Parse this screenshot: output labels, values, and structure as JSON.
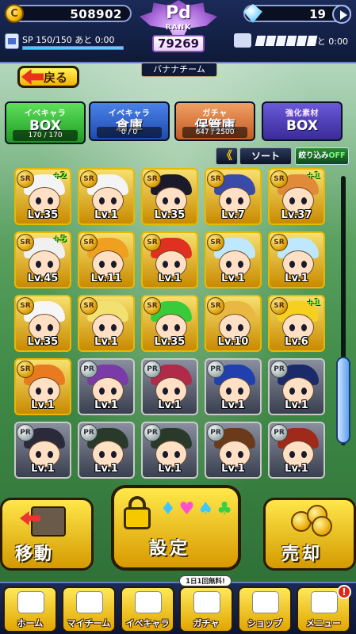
{
  "header": {
    "coins": "508902",
    "gems": "19",
    "sp_text": "SP 150/150 あと  0:00",
    "stamina_text": "あと  0:00",
    "rank_letter": "Pd",
    "rank_label": "RANK",
    "rank_value": "79269",
    "team_name": "バナナチーム",
    "back_label": "戻る"
  },
  "tabs": [
    {
      "line1": "イベキャラ",
      "line2": "BOX",
      "count": "170 / 170"
    },
    {
      "line1": "イベキャラ",
      "line2": "倉庫",
      "count": "0 / 0"
    },
    {
      "line1": "ガチャ",
      "line2": "保管庫",
      "count": "647 / 2500"
    },
    {
      "line1": "強化素材",
      "line2": "BOX",
      "count": ""
    }
  ],
  "toolbar": {
    "sort_arrow": "《",
    "sort_label": "ソート",
    "filter_label": "絞り込み",
    "filter_state": "OFF"
  },
  "cards": [
    {
      "rarity": "SR",
      "level": "Lv.35",
      "plus": "+2",
      "hair": "#f4f4f4"
    },
    {
      "rarity": "SR",
      "level": "Lv.1",
      "plus": "",
      "hair": "#f4f4f4"
    },
    {
      "rarity": "SR",
      "level": "Lv.35",
      "plus": "",
      "hair": "#1a1a2a"
    },
    {
      "rarity": "SR",
      "level": "Lv.7",
      "plus": "",
      "hair": "#3a4aa8"
    },
    {
      "rarity": "SR",
      "level": "Lv.37",
      "plus": "+1",
      "hair": "#e08a3a"
    },
    {
      "rarity": "SR",
      "level": "Lv.45",
      "plus": "+5",
      "hair": "#f0f0f0"
    },
    {
      "rarity": "SR",
      "level": "Lv.11",
      "plus": "",
      "hair": "#f0a020"
    },
    {
      "rarity": "SR",
      "level": "Lv.1",
      "plus": "",
      "hair": "#e03020"
    },
    {
      "rarity": "SR",
      "level": "Lv.1",
      "plus": "",
      "hair": "#bfe8ff"
    },
    {
      "rarity": "SR",
      "level": "Lv.1",
      "plus": "",
      "hair": "#bfe8ff"
    },
    {
      "rarity": "SR",
      "level": "Lv.35",
      "plus": "",
      "hair": "#f6f6f6"
    },
    {
      "rarity": "SR",
      "level": "Lv.1",
      "plus": "",
      "hair": "#f2e070"
    },
    {
      "rarity": "SR",
      "level": "Lv.35",
      "plus": "",
      "hair": "#3acb3a"
    },
    {
      "rarity": "SR",
      "level": "Lv.10",
      "plus": "",
      "hair": "#e8b840"
    },
    {
      "rarity": "SR",
      "level": "Lv.6",
      "plus": "+1",
      "hair": "#f5d020"
    },
    {
      "rarity": "SR",
      "level": "Lv.1",
      "plus": "",
      "hair": "#e87a20"
    },
    {
      "rarity": "PR",
      "level": "Lv.1",
      "plus": "",
      "hair": "#7a3aa8"
    },
    {
      "rarity": "PR",
      "level": "Lv.1",
      "plus": "",
      "hair": "#b02a4a"
    },
    {
      "rarity": "PR",
      "level": "Lv.1",
      "plus": "",
      "hair": "#2040b0"
    },
    {
      "rarity": "PR",
      "level": "Lv.1",
      "plus": "",
      "hair": "#1a2a6a"
    },
    {
      "rarity": "PR",
      "level": "Lv.1",
      "plus": "",
      "hair": "#2a2a3a"
    },
    {
      "rarity": "PR",
      "level": "Lv.1",
      "plus": "",
      "hair": "#2a3a2a"
    },
    {
      "rarity": "PR",
      "level": "Lv.1",
      "plus": "",
      "hair": "#2a3a2a"
    },
    {
      "rarity": "PR",
      "level": "Lv.1",
      "plus": "",
      "hair": "#6a3a1a"
    },
    {
      "rarity": "PR",
      "level": "Lv.1",
      "plus": "",
      "hair": "#a02a1a"
    }
  ],
  "actions": {
    "move_label": "移動",
    "settings_label": "設定",
    "sell_label": "売却"
  },
  "nav": {
    "items": [
      {
        "label": "ホーム"
      },
      {
        "label": "マイチーム"
      },
      {
        "label": "イベキャラ"
      },
      {
        "label": "ガチャ"
      },
      {
        "label": "ショップ"
      },
      {
        "label": "メニュー"
      }
    ],
    "gacha_badge": "1日1回無料!",
    "alert": "!"
  }
}
